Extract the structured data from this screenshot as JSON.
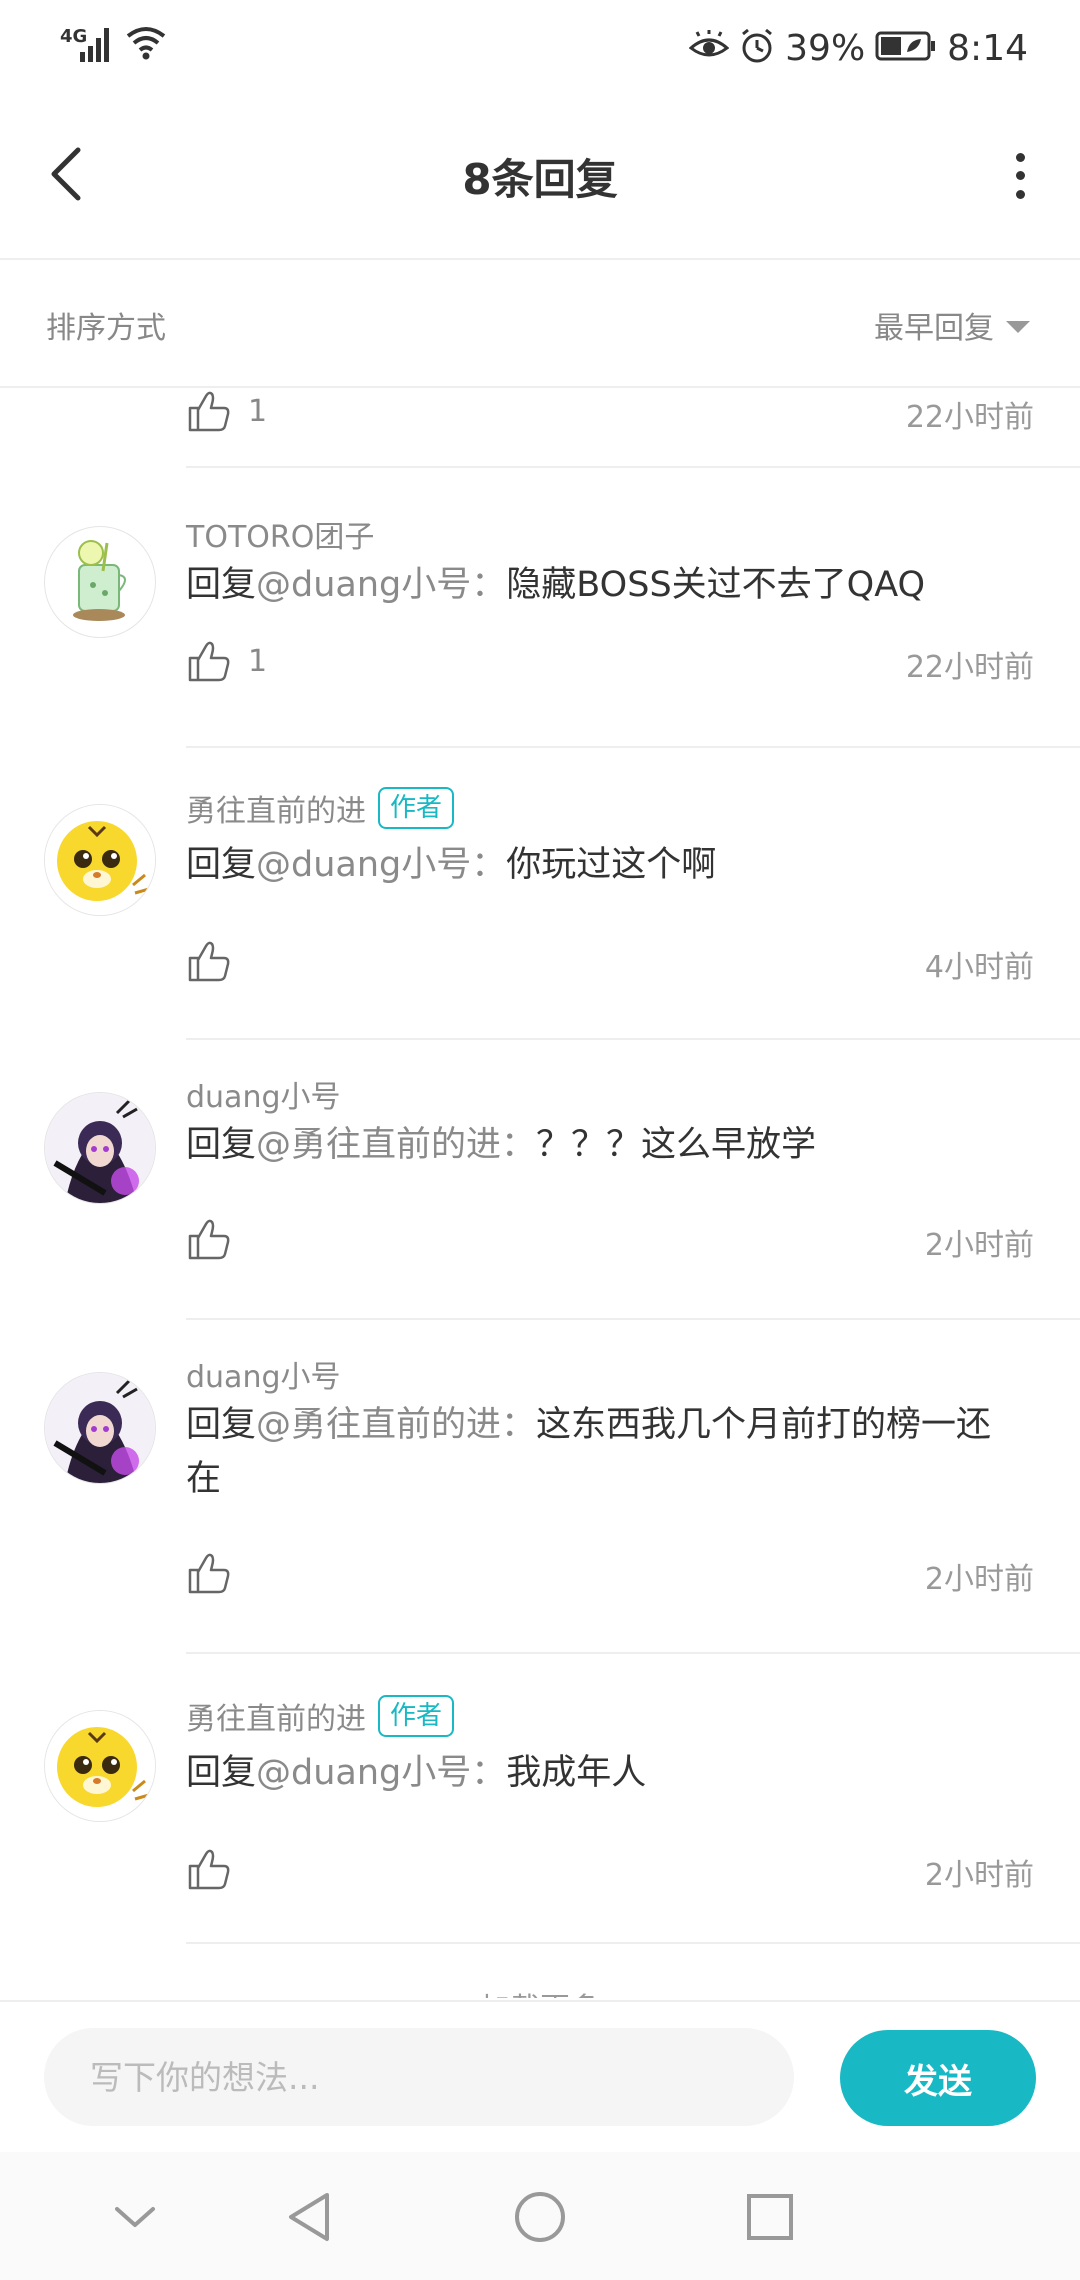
{
  "status_bar": {
    "network": "4G",
    "battery": "39%",
    "time": "8:14"
  },
  "header": {
    "title": "8条回复"
  },
  "sort": {
    "label": "排序方式",
    "selected": "最早回复"
  },
  "top_partial": {
    "likes": "1",
    "time": "22小时前"
  },
  "comments": [
    {
      "username": "TOTORO团子",
      "badge": "",
      "reply_prefix": "回复",
      "mention": "@duang小号",
      "separator": "：",
      "text": "隐藏BOSS关过不去了QAQ",
      "likes": "1",
      "time": "22小时前"
    },
    {
      "username": "勇往直前的进",
      "badge": "作者",
      "reply_prefix": "回复",
      "mention": "@duang小号",
      "separator": "：",
      "text": "你玩过这个啊",
      "likes": "",
      "time": "4小时前"
    },
    {
      "username": "duang小号",
      "badge": "",
      "reply_prefix": "回复",
      "mention": "@勇往直前的进",
      "separator": "：",
      "text": "？？？这么早放学",
      "likes": "",
      "time": "2小时前"
    },
    {
      "username": "duang小号",
      "badge": "",
      "reply_prefix": "回复",
      "mention": "@勇往直前的进",
      "separator": "：",
      "text": "这东西我几个月前打的榜一还在",
      "likes": "",
      "time": "2小时前"
    },
    {
      "username": "勇往直前的进",
      "badge": "作者",
      "reply_prefix": "回复",
      "mention": "@duang小号",
      "separator": "：",
      "text": "我成年人",
      "likes": "",
      "time": "2小时前"
    }
  ],
  "load_more": "加载更多",
  "input": {
    "placeholder": "写下你的想法...",
    "send_label": "发送"
  },
  "colors": {
    "accent": "#18b9c4",
    "text_primary": "#333333",
    "text_secondary": "#8a8a8a"
  }
}
